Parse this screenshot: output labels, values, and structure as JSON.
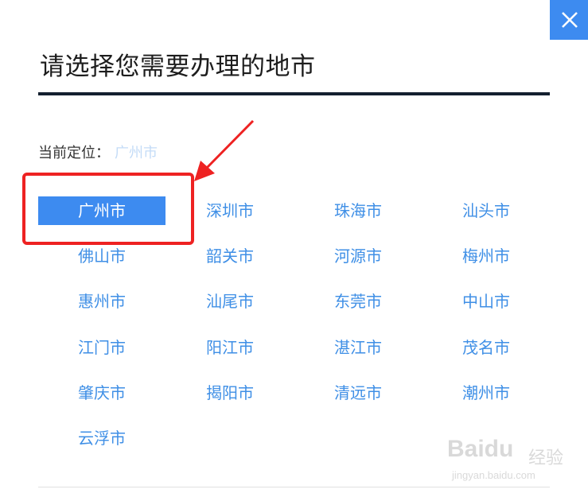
{
  "dialog": {
    "title": "请选择您需要办理的地市",
    "close_icon": "close-icon",
    "accent_color": "#3d8bf0"
  },
  "current_location": {
    "label": "当前定位：",
    "value": "广州市"
  },
  "cities": [
    {
      "name": "广州市",
      "selected": true
    },
    {
      "name": "深圳市"
    },
    {
      "name": "珠海市"
    },
    {
      "name": "汕头市"
    },
    {
      "name": "佛山市"
    },
    {
      "name": "韶关市"
    },
    {
      "name": "河源市"
    },
    {
      "name": "梅州市"
    },
    {
      "name": "惠州市"
    },
    {
      "name": "汕尾市"
    },
    {
      "name": "东莞市"
    },
    {
      "name": "中山市"
    },
    {
      "name": "江门市"
    },
    {
      "name": "阳江市"
    },
    {
      "name": "湛江市"
    },
    {
      "name": "茂名市"
    },
    {
      "name": "肇庆市"
    },
    {
      "name": "揭阳市"
    },
    {
      "name": "清远市"
    },
    {
      "name": "潮州市"
    },
    {
      "name": "云浮市"
    }
  ],
  "watermark": {
    "logo": "Baidu",
    "text": "经验",
    "url": "jingyan.baidu.com"
  }
}
